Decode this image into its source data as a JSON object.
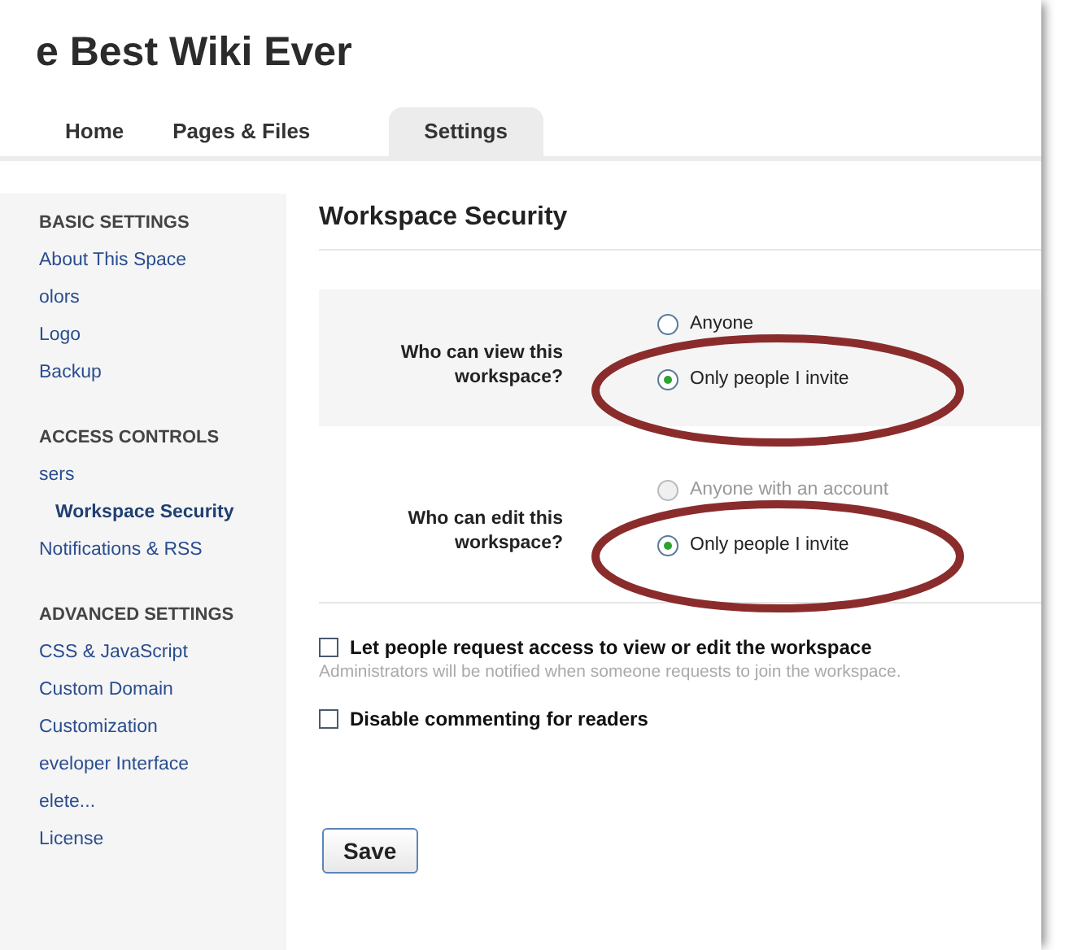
{
  "site_title": "e Best Wiki Ever",
  "tabs": [
    {
      "label": "Home",
      "selected": false
    },
    {
      "label": "Pages & Files",
      "selected": false
    },
    {
      "label": "Settings",
      "selected": true
    }
  ],
  "sidebar": {
    "groups": [
      {
        "heading": "BASIC SETTINGS",
        "items": [
          {
            "label": "About This Space",
            "selected": false
          },
          {
            "label": "olors",
            "selected": false
          },
          {
            "label": "Logo",
            "selected": false
          },
          {
            "label": "Backup",
            "selected": false
          }
        ]
      },
      {
        "heading": "ACCESS CONTROLS",
        "items": [
          {
            "label": "sers",
            "selected": false
          },
          {
            "label": "Workspace Security",
            "selected": true
          },
          {
            "label": "Notifications & RSS",
            "selected": false
          }
        ]
      },
      {
        "heading": "ADVANCED SETTINGS",
        "items": [
          {
            "label": "CSS & JavaScript",
            "selected": false
          },
          {
            "label": "Custom Domain",
            "selected": false
          },
          {
            "label": "Customization",
            "selected": false
          },
          {
            "label": "eveloper Interface",
            "selected": false
          },
          {
            "label": "elete...",
            "selected": false
          },
          {
            "label": "License",
            "selected": false
          }
        ]
      }
    ]
  },
  "heading": "Workspace Security",
  "questions": [
    {
      "label": "Who can view this workspace?",
      "options": [
        {
          "label": "Anyone",
          "selected": false,
          "disabled": false
        },
        {
          "label": "Only people I invite",
          "selected": true,
          "disabled": false
        }
      ]
    },
    {
      "label": "Who can edit this workspace?",
      "options": [
        {
          "label": "Anyone with an account",
          "selected": false,
          "disabled": true
        },
        {
          "label": "Only people I invite",
          "selected": true,
          "disabled": false
        }
      ]
    }
  ],
  "checkboxes": [
    {
      "label": "Let people request access to view or edit the workspace",
      "checked": false,
      "hint": "Administrators will be notified when someone requests to join the workspace."
    },
    {
      "label": "Disable commenting for readers",
      "checked": false
    }
  ],
  "save_button": "Save"
}
